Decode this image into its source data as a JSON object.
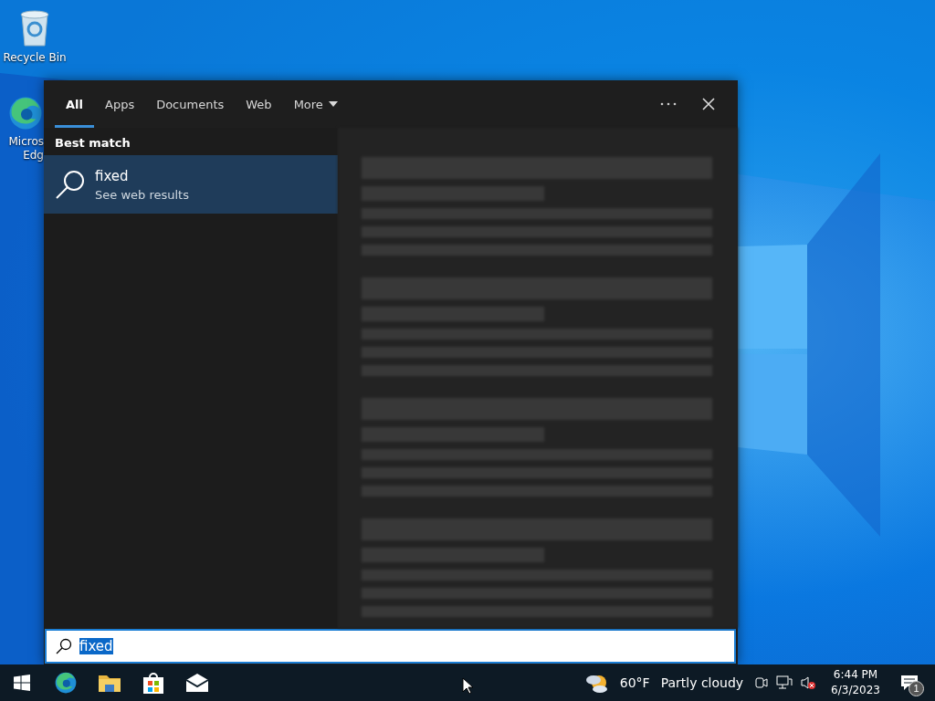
{
  "desktop_icons": [
    {
      "kind": "recycle",
      "label_lines": [
        "Recycle Bin"
      ]
    },
    {
      "kind": "edge",
      "label_lines": [
        "Micros",
        "Edg"
      ]
    }
  ],
  "search_panel": {
    "tabs": [
      {
        "label": "All",
        "selected": true,
        "dropdown": false
      },
      {
        "label": "Apps",
        "selected": false,
        "dropdown": false
      },
      {
        "label": "Documents",
        "selected": false,
        "dropdown": false
      },
      {
        "label": "Web",
        "selected": false,
        "dropdown": false
      },
      {
        "label": "More",
        "selected": false,
        "dropdown": true
      }
    ],
    "section_heading": "Best match",
    "results": [
      {
        "title": "fixed",
        "subtitle": "See web results",
        "selected": true
      }
    ],
    "search_box": {
      "value": "fixed",
      "text_selected": true
    }
  },
  "taskbar": {
    "pinned": [
      {
        "kind": "edge"
      },
      {
        "kind": "folder"
      },
      {
        "kind": "store"
      },
      {
        "kind": "mail"
      }
    ],
    "weather": {
      "temperature": "60°F",
      "condition": "Partly cloudy"
    },
    "clock": {
      "time": "6:44 PM",
      "date": "6/3/2023"
    },
    "notifications": {
      "count": "1"
    }
  }
}
